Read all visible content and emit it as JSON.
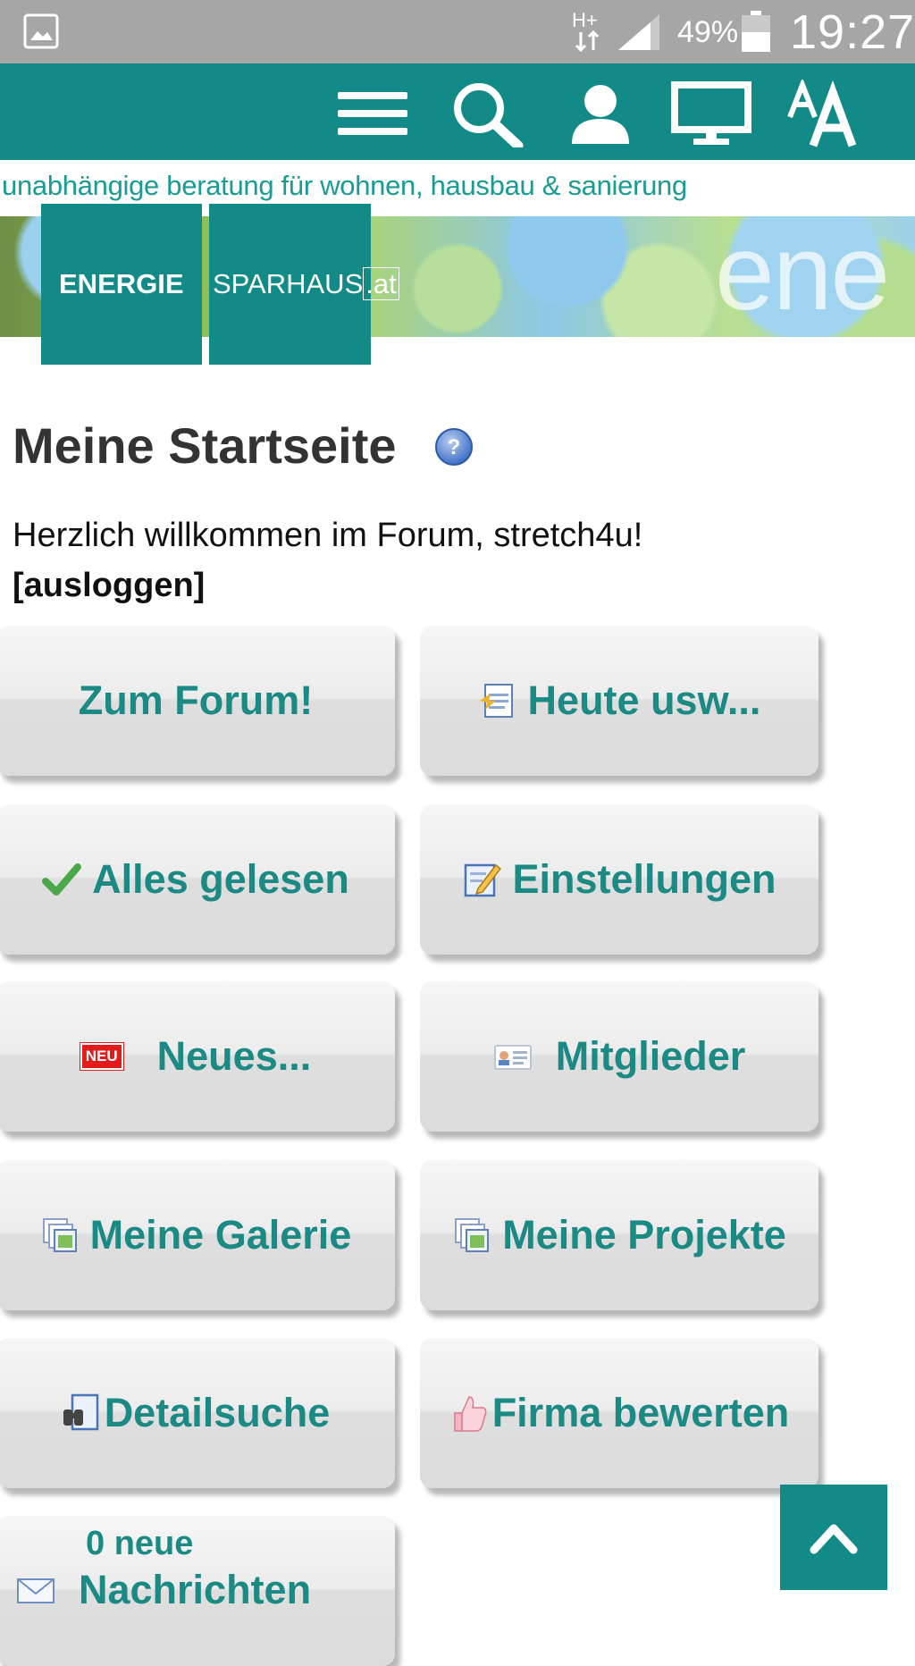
{
  "status_bar": {
    "network_type": "H+",
    "battery_percent": "49%",
    "time": "19:27"
  },
  "tagline": "unabhängige beratung für wohnen, hausbau & sanierung",
  "logo": {
    "word1": "ENERGIE",
    "word2": "SPARHAUS",
    "tld": ".at"
  },
  "banner": {
    "watermark": "ene"
  },
  "page": {
    "title": "Meine Startseite",
    "welcome": "Herzlich willkommen im Forum, stretch4u!",
    "logout": "[ausloggen]"
  },
  "tiles": {
    "forum": "Zum Forum!",
    "today": "Heute usw...",
    "mark_read": "Alles gelesen",
    "settings": "Einstellungen",
    "new_badge": "NEU",
    "news": "Neues...",
    "members": "Mitglieder",
    "gallery": "Meine Galerie",
    "projects": "Meine Projekte",
    "search": "Detailsuche",
    "rate": "Firma bewerten",
    "messages_count": "0 neue",
    "messages": "Nachrichten"
  },
  "colors": {
    "brand_teal": "#128a87",
    "tile_text": "#1b8984",
    "status_bar": "#a6a6a6"
  }
}
